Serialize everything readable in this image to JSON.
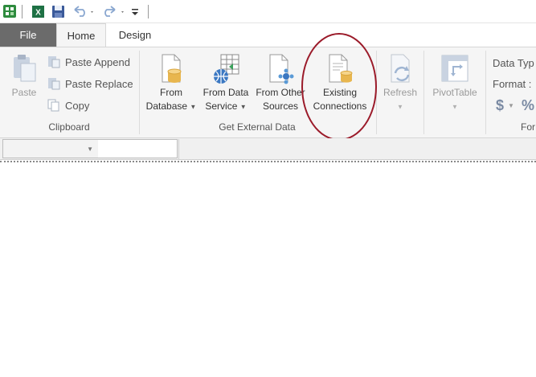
{
  "quick_access": {
    "icons": [
      "app-icon",
      "excel-icon",
      "save-icon",
      "undo-icon",
      "redo-icon",
      "customize-icon"
    ]
  },
  "tabs": [
    {
      "label": "File",
      "active": false
    },
    {
      "label": "Home",
      "active": true
    },
    {
      "label": "Design",
      "active": false
    }
  ],
  "clipboard": {
    "paste_label": "Paste",
    "paste_append_label": "Paste Append",
    "paste_replace_label": "Paste Replace",
    "copy_label": "Copy",
    "group_label": "Clipboard"
  },
  "get_external_data": {
    "from_database": {
      "line1": "From",
      "line2": "Database"
    },
    "from_data_service": {
      "line1": "From Data",
      "line2": "Service"
    },
    "from_other_sources": {
      "line1": "From Other",
      "line2": "Sources"
    },
    "existing_connections": {
      "line1": "Existing",
      "line2": "Connections"
    },
    "group_label": "Get External Data"
  },
  "refresh_label": "Refresh",
  "pivottable_label": "PivotTable",
  "formatting": {
    "data_type_label": "Data Typ",
    "format_label": "Format :",
    "currency_symbol": "$",
    "percent_symbol": "%",
    "group_label": "For"
  },
  "colors": {
    "file_tab": "#6b6b6b",
    "annotation": "#9b1b2a",
    "excel_green": "#1e7145",
    "save_blue": "#3b5a9a"
  }
}
